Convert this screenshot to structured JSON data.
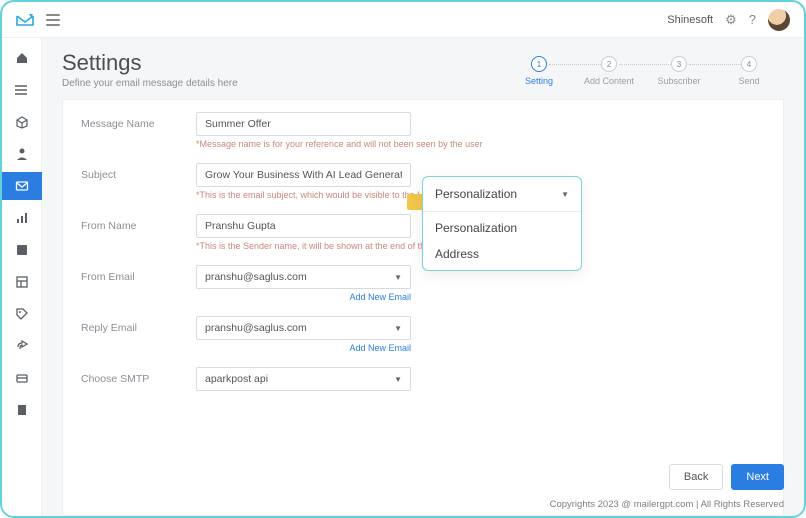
{
  "topbar": {
    "user": "Shinesoft"
  },
  "header": {
    "title": "Settings",
    "subtitle": "Define your email message details here"
  },
  "steps": [
    {
      "num": "1",
      "label": "Setting"
    },
    {
      "num": "2",
      "label": "Add Content"
    },
    {
      "num": "3",
      "label": "Subscriber"
    },
    {
      "num": "4",
      "label": "Send"
    }
  ],
  "form": {
    "message_name": {
      "label": "Message Name",
      "value": "Summer Offer",
      "hint": "*Message name is for your reference and will not been seen by the user"
    },
    "subject": {
      "label": "Subject",
      "value": "Grow Your Business With AI Lead Generation",
      "hint": "*This is the email subject, which would be visible to the Lead"
    },
    "from_name": {
      "label": "From Name",
      "value": "Pranshu Gupta",
      "hint": "*This is the Sender name, it will be shown at the end of the email"
    },
    "from_email": {
      "label": "From Email",
      "value": "pranshu@saglus.com",
      "add": "Add New Email"
    },
    "reply_email": {
      "label": "Reply Email",
      "value": "pranshu@saglus.com",
      "add": "Add New Email"
    },
    "smtp": {
      "label": "Choose SMTP",
      "value": "aparkpost api"
    }
  },
  "dropdown": {
    "selected": "Personalization",
    "options": [
      "Personalization",
      "Address"
    ]
  },
  "actions": {
    "back": "Back",
    "next": "Next"
  },
  "footer": "Copyrights 2023 @   mailergpt.com | All Rights Reserved"
}
